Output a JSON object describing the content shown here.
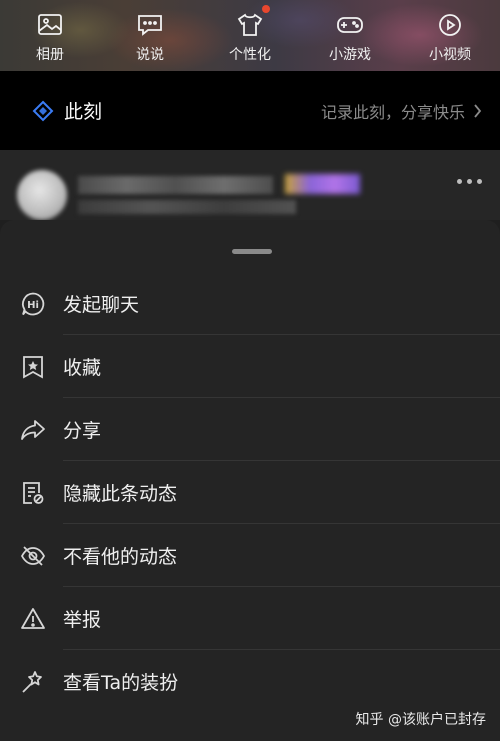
{
  "top_tabs": [
    {
      "label": "相册",
      "icon": "album-icon"
    },
    {
      "label": "说说",
      "icon": "shuoshuo-icon"
    },
    {
      "label": "个性化",
      "icon": "tshirt-icon",
      "badge": "red-dot"
    },
    {
      "label": "小游戏",
      "icon": "gamepad-icon"
    },
    {
      "label": "小视频",
      "icon": "play-icon"
    }
  ],
  "moment": {
    "title": "此刻",
    "subtitle": "记录此刻，分享快乐",
    "accent": "#3b7cf5"
  },
  "menu": [
    {
      "label": "发起聊天",
      "icon": "chat-hi-icon"
    },
    {
      "label": "收藏",
      "icon": "bookmark-star-icon"
    },
    {
      "label": "分享",
      "icon": "share-arrow-icon"
    },
    {
      "label": "隐藏此条动态",
      "icon": "hide-document-icon"
    },
    {
      "label": "不看他的动态",
      "icon": "eye-off-icon"
    },
    {
      "label": "举报",
      "icon": "warning-triangle-icon"
    },
    {
      "label": "查看Ta的装扮",
      "icon": "magic-wand-icon"
    }
  ],
  "watermark": "知乎 @该账户已封存",
  "colors": {
    "badge": "#e8472e",
    "sheet": "#242424",
    "moment_bg": "#000000"
  }
}
